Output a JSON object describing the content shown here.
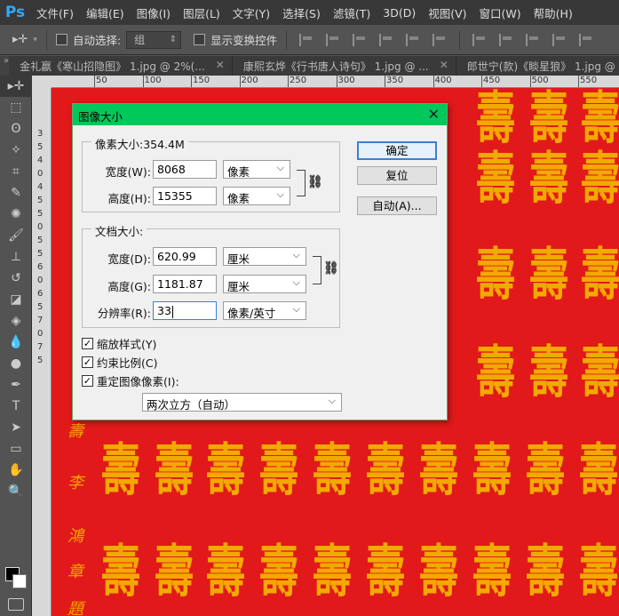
{
  "app": {
    "logo": "Ps"
  },
  "menu": [
    "文件(F)",
    "编辑(E)",
    "图像(I)",
    "图层(L)",
    "文字(Y)",
    "选择(S)",
    "滤镜(T)",
    "3D(D)",
    "视图(V)",
    "窗口(W)",
    "帮助(H)"
  ],
  "options_bar": {
    "auto_select_label": "自动选择:",
    "auto_select_value": "组",
    "show_transform_label": "显示变换控件"
  },
  "tabs": [
    {
      "label": "金礼嬴《寒山招隐图》 1.jpg @ 2%(..."
    },
    {
      "label": "康熙玄烨《行书唐人诗句》 1.jpg @ ..."
    },
    {
      "label": "郎世宁(款)《睒星狼》 1.jpg @ 1..."
    }
  ],
  "ruler": {
    "top": [
      "50",
      "100",
      "150",
      "200",
      "250",
      "300",
      "350",
      "400",
      "450",
      "500",
      "550"
    ],
    "left": [
      "3",
      "5",
      "4",
      "0",
      "4",
      "5",
      "5",
      "0",
      "5",
      "5",
      "6",
      "0",
      "6",
      "5",
      "7",
      "0",
      "7",
      "5"
    ]
  },
  "dialog": {
    "title": "图像大小",
    "pixel_dims_legend": "像素大小:354.4M",
    "width_label": "宽度(W):",
    "width_value": "8068",
    "width_unit": "像素",
    "height_label": "高度(H):",
    "height_value": "15355",
    "height_unit": "像素",
    "doc_size_legend": "文档大小:",
    "doc_width_label": "宽度(D):",
    "doc_width_value": "620.99",
    "doc_width_unit": "厘米",
    "doc_height_label": "高度(G):",
    "doc_height_value": "1181.87",
    "doc_height_unit": "厘米",
    "resolution_label": "分辨率(R):",
    "resolution_value": "33",
    "resolution_unit": "像素/英寸",
    "scale_styles_label": "缩放样式(Y)",
    "constrain_label": "约束比例(C)",
    "resample_label": "重定图像像素(I):",
    "resample_method": "两次立方（自动）",
    "ok_label": "确定",
    "reset_label": "复位",
    "auto_label": "自动(A)...",
    "check_mark": "✓",
    "close_icon": "✕"
  },
  "colors": {
    "canvas_red": "#e1191a",
    "glyph_gold": "#f2a900",
    "title_green": "#00c85a"
  }
}
